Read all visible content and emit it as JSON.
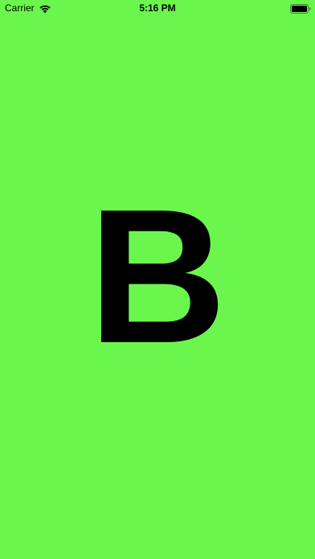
{
  "status_bar": {
    "carrier": "Carrier",
    "time": "5:16 PM",
    "wifi_icon": "wifi-icon",
    "battery_icon": "battery-icon"
  },
  "main": {
    "letter": "B",
    "background_color": "#6BF64E",
    "text_color": "#000000"
  }
}
